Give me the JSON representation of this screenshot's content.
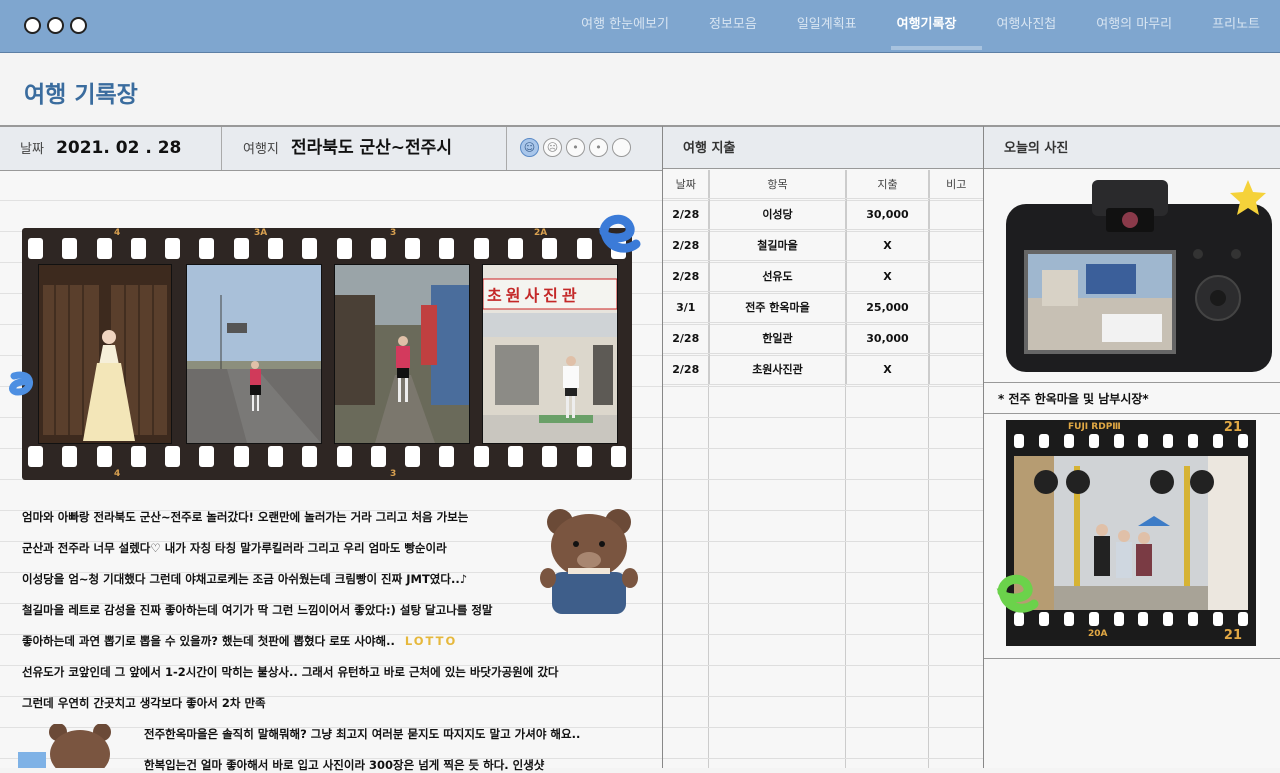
{
  "nav": {
    "items": [
      "여행 한눈에보기",
      "정보모음",
      "일일계획표",
      "여행기록장",
      "여행사진첩",
      "여행의 마무리",
      "프리노트"
    ],
    "active_index": 3
  },
  "page": {
    "title": "여행 기록장"
  },
  "record": {
    "date_label": "날짜",
    "date_value": "2021. 02 . 28",
    "destination_label": "여행지",
    "destination_value": "전라북도 군산~전주시",
    "mood_selected_index": 0
  },
  "film": {
    "top_labels": [
      "4",
      "3A",
      "3",
      "2A"
    ],
    "bottom_labels": [
      "4",
      "3"
    ],
    "photo_sign_text": "초원사진관"
  },
  "diary": {
    "lines": [
      "엄마와 아빠랑 전라북도 군산~전주로 놀러갔다! 오랜만에 놀러가는 거라 그리고 처음 가보는",
      "군산과 전주라 너무 설렜다♡ 내가 자칭 타칭 말가루킬러라 그리고 우리 엄마도 빵순이라",
      "이성당을 엄~청 기대했다 그런데 야채고로케는 조금 아쉬웠는데 크림빵이 진짜 JMT였다..♪",
      "철길마을 레트로 감성을 진짜 좋아하는데 여기가 딱 그런 느낌이어서 좋았다:) 설탕 달고나를 정말",
      "좋아하는데 과연 뽑기로 뽑을 수 있을까? 했는데 첫판에 뽑혔다 로또 사야해..",
      "선유도가 코앞인데 그 앞에서 1-2시간이 막히는 불상사.. 그래서 유턴하고 바로 근처에 있는 바닷가공원에 갔다",
      "그런데 우연히 간곳치고 생각보다 좋아서 2차 만족",
      "전주한옥마을은 솔직히 말해뭐해? 그냥 최고지 여러분 묻지도 따지지도 말고 가셔야 해요..",
      "한복입는건 얼마 좋아해서 바로 입고 사진이라 300장은 넘게 찍은 듯 하다. 인생샷"
    ],
    "lotto": "LOTTO"
  },
  "expenses": {
    "title": "여행 지출",
    "columns": [
      "날짜",
      "항목",
      "지출",
      "비고"
    ],
    "rows": [
      [
        "2/28",
        "이성당",
        "30,000",
        ""
      ],
      [
        "2/28",
        "철길마을",
        "X",
        ""
      ],
      [
        "2/28",
        "선유도",
        "X",
        ""
      ],
      [
        "3/1",
        "전주 한옥마을",
        "25,000",
        ""
      ],
      [
        "2/28",
        "한일관",
        "30,000",
        ""
      ],
      [
        "2/28",
        "초원사진관",
        "X",
        ""
      ]
    ]
  },
  "photo_panel": {
    "title": "오늘의 사진",
    "caption": "* 전주 한옥마을 및 남부시장*",
    "film_top_text": "FUJI RDPⅢ",
    "film_number": "21",
    "film_bottom_text": "20A"
  },
  "colors": {
    "nav_bg": "#7fa6cf",
    "title": "#3a6c9e",
    "accent_mood": "#a9c6ea"
  }
}
